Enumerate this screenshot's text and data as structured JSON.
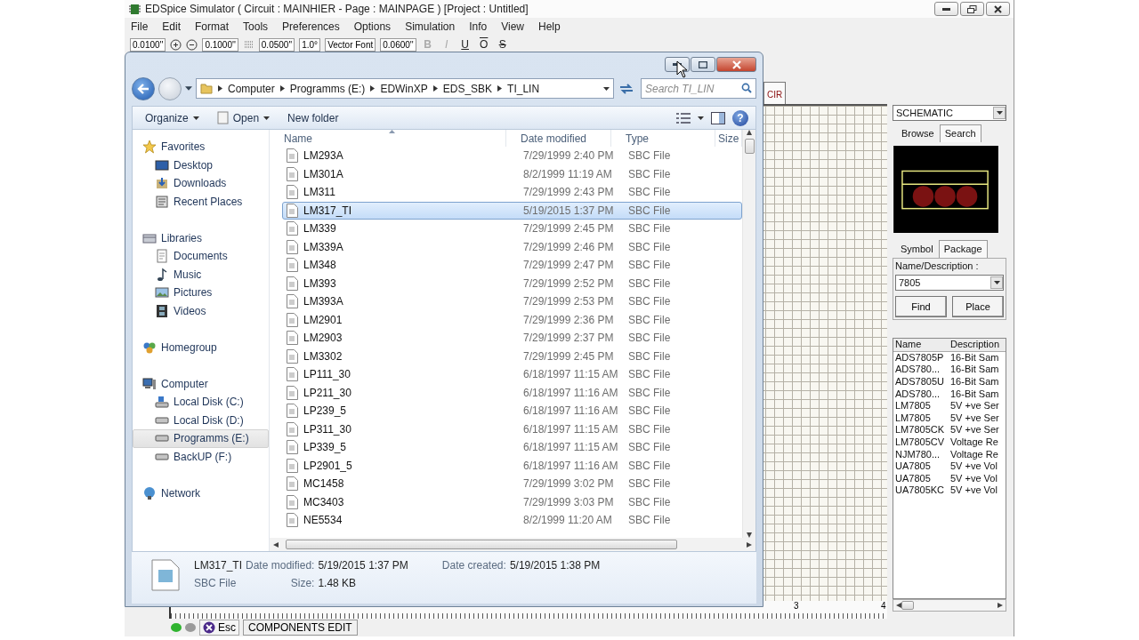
{
  "window": {
    "title": "EDSpice Simulator ( Circuit : MAINHIER - Page : MAINPAGE ) [Project : Untitled]"
  },
  "menu": [
    "File",
    "Edit",
    "Format",
    "Tools",
    "Preferences",
    "Options",
    "Simulation",
    "Info",
    "View",
    "Help"
  ],
  "toolbar": {
    "combos": [
      "0.0100''",
      "0.1000''",
      "0.0500''",
      "1.0°",
      "Vector Font",
      "0.0600''"
    ],
    "format_buttons": [
      {
        "label": "B",
        "disabled": true
      },
      {
        "label": "I",
        "disabled": true
      },
      {
        "label": "U",
        "disabled": false
      },
      {
        "label": "O",
        "disabled": false
      },
      {
        "label": "S",
        "disabled": false
      }
    ]
  },
  "explorer": {
    "address": [
      "Computer",
      "Programms (E:)",
      "EDWinXP",
      "EDS_SBK",
      "TI_LIN"
    ],
    "search": {
      "placeholder": "Search TI_LIN"
    },
    "commands": [
      {
        "label": "Organize",
        "dropdown": true
      },
      {
        "label": "Open",
        "dropdown": true
      },
      {
        "label": "New folder",
        "dropdown": false
      }
    ],
    "help": "?",
    "nav": [
      {
        "label": "Favorites",
        "kind": "favorites",
        "selected": false,
        "children": [
          {
            "label": "Desktop",
            "kind": "desktop",
            "selected": false
          },
          {
            "label": "Downloads",
            "kind": "downloads",
            "selected": false
          },
          {
            "label": "Recent Places",
            "kind": "recent",
            "selected": false
          }
        ]
      },
      {
        "label": "Libraries",
        "kind": "library",
        "selected": false,
        "children": [
          {
            "label": "Documents",
            "kind": "document",
            "selected": false
          },
          {
            "label": "Music",
            "kind": "music",
            "selected": false
          },
          {
            "label": "Pictures",
            "kind": "picture",
            "selected": false
          },
          {
            "label": "Videos",
            "kind": "video",
            "selected": false
          }
        ]
      },
      {
        "label": "Homegroup",
        "kind": "homegroup",
        "selected": false
      },
      {
        "label": "Computer",
        "kind": "computer",
        "selected": false,
        "children": [
          {
            "label": "Local Disk (C:)",
            "kind": "system-disk",
            "selected": false
          },
          {
            "label": "Local Disk (D:)",
            "kind": "disk",
            "selected": false
          },
          {
            "label": "Programms (E:)",
            "kind": "disk",
            "selected": true
          },
          {
            "label": "BackUP (F:)",
            "kind": "disk",
            "selected": false
          }
        ]
      },
      {
        "label": "Network",
        "kind": "network",
        "selected": false
      }
    ],
    "columns": [
      "Name",
      "Date modified",
      "Type",
      "Size"
    ],
    "files": [
      {
        "name": "LM293A",
        "modified": "7/29/1999 2:40 PM",
        "type": "SBC File",
        "selected": false
      },
      {
        "name": "LM301A",
        "modified": "8/2/1999 11:19 AM",
        "type": "SBC File",
        "selected": false
      },
      {
        "name": "LM311",
        "modified": "7/29/1999 2:43 PM",
        "type": "SBC File",
        "selected": false
      },
      {
        "name": "LM317_TI",
        "modified": "5/19/2015 1:37 PM",
        "type": "SBC File",
        "selected": true
      },
      {
        "name": "LM339",
        "modified": "7/29/1999 2:45 PM",
        "type": "SBC File",
        "selected": false
      },
      {
        "name": "LM339A",
        "modified": "7/29/1999 2:46 PM",
        "type": "SBC File",
        "selected": false
      },
      {
        "name": "LM348",
        "modified": "7/29/1999 2:47 PM",
        "type": "SBC File",
        "selected": false
      },
      {
        "name": "LM393",
        "modified": "7/29/1999 2:52 PM",
        "type": "SBC File",
        "selected": false
      },
      {
        "name": "LM393A",
        "modified": "7/29/1999 2:53 PM",
        "type": "SBC File",
        "selected": false
      },
      {
        "name": "LM2901",
        "modified": "7/29/1999 2:36 PM",
        "type": "SBC File",
        "selected": false
      },
      {
        "name": "LM2903",
        "modified": "7/29/1999 2:37 PM",
        "type": "SBC File",
        "selected": false
      },
      {
        "name": "LM3302",
        "modified": "7/29/1999 2:45 PM",
        "type": "SBC File",
        "selected": false
      },
      {
        "name": "LP111_30",
        "modified": "6/18/1997 11:15 AM",
        "type": "SBC File",
        "selected": false
      },
      {
        "name": "LP211_30",
        "modified": "6/18/1997 11:16 AM",
        "type": "SBC File",
        "selected": false
      },
      {
        "name": "LP239_5",
        "modified": "6/18/1997 11:16 AM",
        "type": "SBC File",
        "selected": false
      },
      {
        "name": "LP311_30",
        "modified": "6/18/1997 11:15 AM",
        "type": "SBC File",
        "selected": false
      },
      {
        "name": "LP339_5",
        "modified": "6/18/1997 11:15 AM",
        "type": "SBC File",
        "selected": false
      },
      {
        "name": "LP2901_5",
        "modified": "6/18/1997 11:16 AM",
        "type": "SBC File",
        "selected": false
      },
      {
        "name": "MC1458",
        "modified": "7/29/1999 3:02 PM",
        "type": "SBC File",
        "selected": false
      },
      {
        "name": "MC3403",
        "modified": "7/29/1999 3:03 PM",
        "type": "SBC File",
        "selected": false
      },
      {
        "name": "NE5534",
        "modified": "8/2/1999 11:20 AM",
        "type": "SBC File",
        "selected": false
      }
    ],
    "details": {
      "name": "LM317_TI",
      "type": "SBC File",
      "fields": [
        {
          "label": "Date modified:",
          "value": "5/19/2015 1:37 PM"
        },
        {
          "label": "Date created:",
          "value": "5/19/2015 1:38 PM"
        },
        {
          "label": "Size:",
          "value": "1.48 KB"
        }
      ]
    }
  },
  "canvas": {
    "tab": "CIR",
    "ruler_labels": [
      "3",
      "4"
    ]
  },
  "library": {
    "view": "SCHEMATIC",
    "tabs": [
      {
        "label": "Browse",
        "selected": false
      },
      {
        "label": "Search",
        "selected": true
      }
    ],
    "subtabs": [
      {
        "label": "Symbol",
        "selected": false
      },
      {
        "label": "Package",
        "selected": true
      }
    ],
    "search_label": "Name/Description :",
    "search_value": "7805",
    "buttons": [
      "Find",
      "Place"
    ],
    "columns": [
      "Name",
      "Description"
    ],
    "results": [
      {
        "name": "ADS7805P",
        "description": "16-Bit Sam"
      },
      {
        "name": "ADS780...",
        "description": "16-Bit Sam"
      },
      {
        "name": "ADS7805U",
        "description": "16-Bit Sam"
      },
      {
        "name": "ADS780...",
        "description": "16-Bit Sam"
      },
      {
        "name": "LM7805",
        "description": "5V +ve Ser"
      },
      {
        "name": "LM7805",
        "description": "5V +ve Ser"
      },
      {
        "name": "LM7805CK",
        "description": "5V +ve Ser"
      },
      {
        "name": "LM7805CV",
        "description": "Voltage Re"
      },
      {
        "name": "NJM780...",
        "description": "Voltage Re"
      },
      {
        "name": "UA7805",
        "description": "5V +ve Vol"
      },
      {
        "name": "UA7805",
        "description": "5V +ve Vol"
      },
      {
        "name": "UA7805KC",
        "description": "5V +ve Vol"
      }
    ]
  },
  "status": {
    "lights": [
      {
        "color": "#2fb32f"
      },
      {
        "color": "#9a9a9a"
      }
    ],
    "esc": "Esc",
    "mode": "COMPONENTS EDIT"
  }
}
